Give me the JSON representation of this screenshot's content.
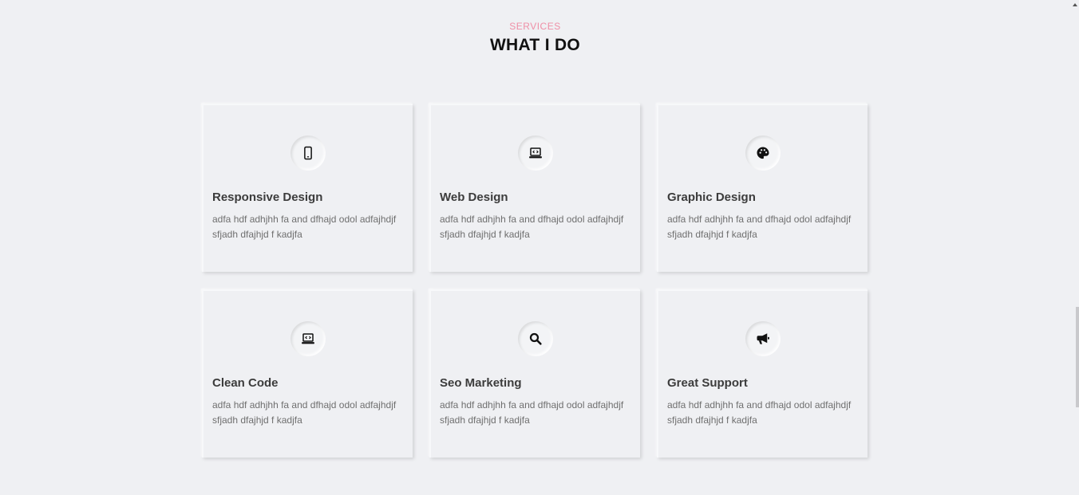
{
  "section": {
    "label": "SERVICES",
    "title": "WHAT I DO"
  },
  "services": [
    {
      "title": "Responsive Design",
      "icon": "mobile-icon",
      "desc": "adfa hdf adhjhh fa and dfhajd odol adfajhdjf sfjadh dfajhjd f kadjfa"
    },
    {
      "title": "Web Design",
      "icon": "laptop-code-icon",
      "desc": "adfa hdf adhjhh fa and dfhajd odol adfajhdjf sfjadh dfajhjd f kadjfa"
    },
    {
      "title": "Graphic Design",
      "icon": "palette-icon",
      "desc": "adfa hdf adhjhh fa and dfhajd odol adfajhdjf sfjadh dfajhjd f kadjfa"
    },
    {
      "title": "Clean Code",
      "icon": "laptop-code-icon",
      "desc": "adfa hdf adhjhh fa and dfhajd odol adfajhdjf sfjadh dfajhjd f kadjfa"
    },
    {
      "title": "Seo Marketing",
      "icon": "search-icon",
      "desc": "adfa hdf adhjhh fa and dfhajd odol adfajhdjf sfjadh dfajhjd f kadjfa"
    },
    {
      "title": "Great Support",
      "icon": "megaphone-icon",
      "desc": "adfa hdf adhjhh fa and dfhajd odol adfajhdjf sfjadh dfajhjd f kadjfa"
    }
  ],
  "colors": {
    "background": "#eff0f3",
    "accent": "#ef8fa6",
    "title": "#111111",
    "card_title": "#3c3c3c",
    "card_text": "#6f6f6f"
  }
}
